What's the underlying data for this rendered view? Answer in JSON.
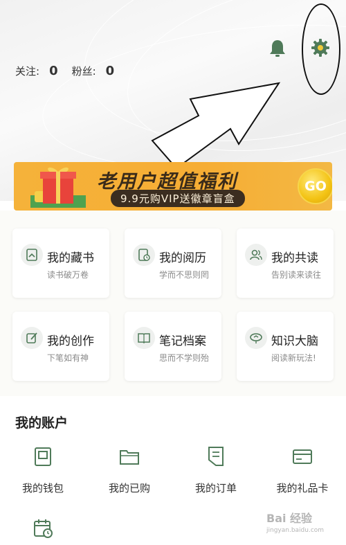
{
  "profile": {
    "follow_label": "关注:",
    "follow_count": "0",
    "fans_label": "粉丝:",
    "fans_count": "0"
  },
  "header_icons": [
    "bell-icon",
    "gear-icon"
  ],
  "banner": {
    "title": "老用户超值福利",
    "subtitle": "9.9元购VIP送徽章盲盒",
    "go_label": "GO"
  },
  "cards": [
    {
      "label": "我的藏书",
      "sub": "读书破万卷",
      "icon": "bookmark-doc-icon"
    },
    {
      "label": "我的阅历",
      "sub": "学而不思则罔",
      "icon": "clock-doc-icon"
    },
    {
      "label": "我的共读",
      "sub": "告别读来读往",
      "icon": "users-icon"
    },
    {
      "label": "我的创作",
      "sub": "下笔如有神",
      "icon": "pen-icon"
    },
    {
      "label": "笔记档案",
      "sub": "思而不学则殆",
      "icon": "book-icon"
    },
    {
      "label": "知识大脑",
      "sub": "阅读新玩法!",
      "icon": "brain-icon"
    }
  ],
  "account": {
    "title": "我的账户",
    "items": [
      {
        "label": "我的钱包",
        "icon": "wallet-icon"
      },
      {
        "label": "我的已购",
        "icon": "folder-icon"
      },
      {
        "label": "我的订单",
        "icon": "order-icon"
      },
      {
        "label": "我的礼品卡",
        "icon": "giftcard-icon"
      },
      {
        "label": "",
        "icon": "calendar-clock-icon"
      }
    ]
  },
  "watermark": {
    "text": "Bai 经验",
    "url": "jingyan.baidu.com"
  },
  "colors": {
    "accent": "#5b7a63",
    "banner": "#f5b23a"
  }
}
